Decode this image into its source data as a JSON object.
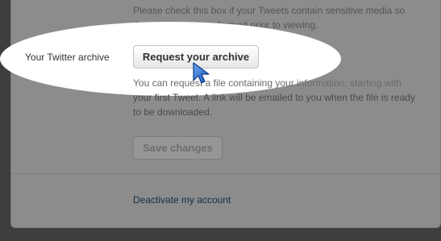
{
  "sensitive_note": {
    "line1": "Please check this box if your Tweets contain sensitive media so",
    "line2": "that users can be informed prior to viewing."
  },
  "archive": {
    "label": "Your Twitter archive",
    "button_label": "Request your archive",
    "help_line1": "You can request a file containing your information, starting with",
    "help_line2": "your first Tweet. A link will be emailed to you when the file is ready",
    "help_line3": "to be downloaded."
  },
  "form": {
    "save_label": "Save changes"
  },
  "footer": {
    "deactivate_label": "Deactivate my account"
  },
  "cursor": {
    "icon": "mouse-pointer-icon",
    "color": "#2f6fd0"
  },
  "colors": {
    "overlay": "#3e3e3e",
    "panel": "#8c8c8c",
    "spotlight": "#ffffff"
  }
}
